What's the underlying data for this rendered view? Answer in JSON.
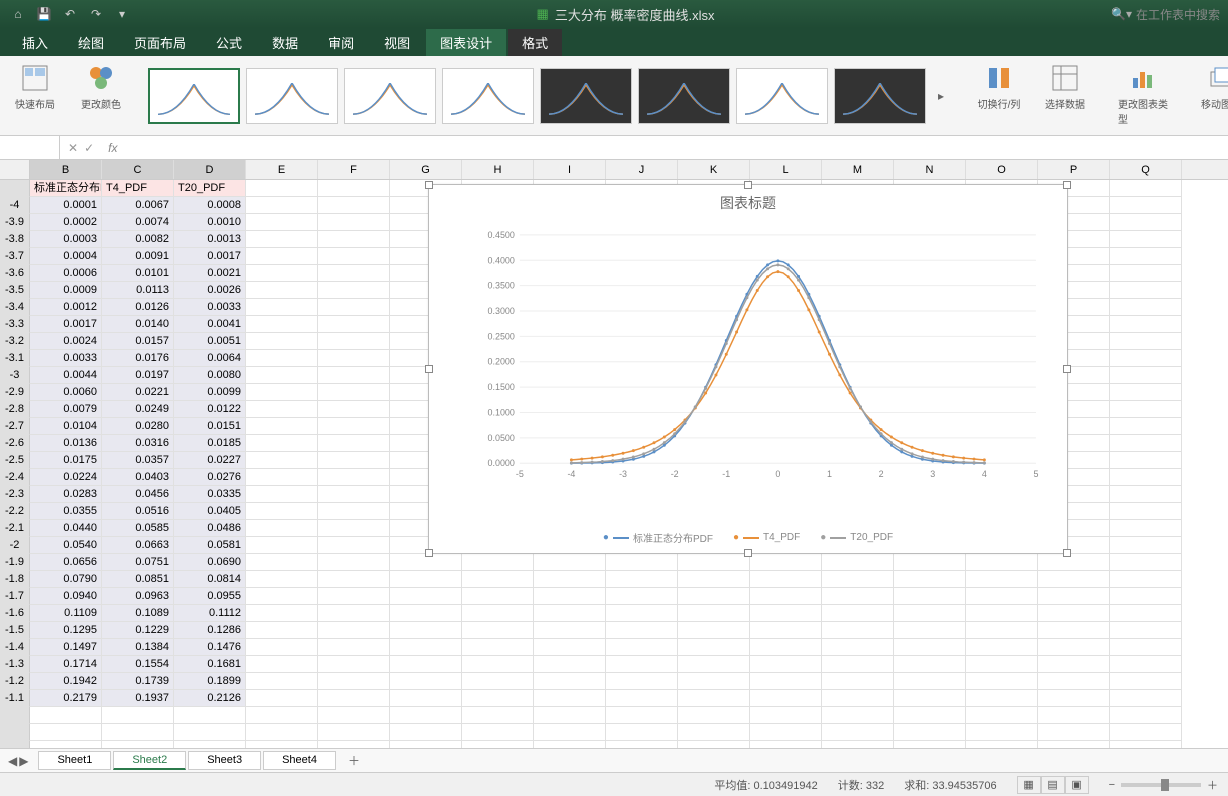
{
  "titlebar": {
    "filename": "三大分布 概率密度曲线.xlsx",
    "search_placeholder": "在工作表中搜索"
  },
  "tabs": [
    "插入",
    "绘图",
    "页面布局",
    "公式",
    "数据",
    "审阅",
    "视图",
    "图表设计",
    "格式"
  ],
  "active_tab": 7,
  "ribbon": {
    "quick_layout": "快速布局",
    "change_color": "更改颜色",
    "switch_rc": "切换行/列",
    "select_data": "选择数据",
    "change_type": "更改图表类型",
    "move_chart": "移动图表"
  },
  "columns": [
    "",
    "B",
    "C",
    "D",
    "E",
    "F",
    "G",
    "H",
    "I",
    "J",
    "K",
    "L",
    "M",
    "N",
    "O",
    "P",
    "Q"
  ],
  "headers": [
    "标准正态分布PDF",
    "T4_PDF",
    "T20_PDF"
  ],
  "rows": [
    {
      "x": "-4",
      "v": [
        "0.0001",
        "0.0067",
        "0.0008"
      ]
    },
    {
      "x": "-3.9",
      "v": [
        "0.0002",
        "0.0074",
        "0.0010"
      ]
    },
    {
      "x": "-3.8",
      "v": [
        "0.0003",
        "0.0082",
        "0.0013"
      ]
    },
    {
      "x": "-3.7",
      "v": [
        "0.0004",
        "0.0091",
        "0.0017"
      ]
    },
    {
      "x": "-3.6",
      "v": [
        "0.0006",
        "0.0101",
        "0.0021"
      ]
    },
    {
      "x": "-3.5",
      "v": [
        "0.0009",
        "0.0113",
        "0.0026"
      ]
    },
    {
      "x": "-3.4",
      "v": [
        "0.0012",
        "0.0126",
        "0.0033"
      ]
    },
    {
      "x": "-3.3",
      "v": [
        "0.0017",
        "0.0140",
        "0.0041"
      ]
    },
    {
      "x": "-3.2",
      "v": [
        "0.0024",
        "0.0157",
        "0.0051"
      ]
    },
    {
      "x": "-3.1",
      "v": [
        "0.0033",
        "0.0176",
        "0.0064"
      ]
    },
    {
      "x": "-3",
      "v": [
        "0.0044",
        "0.0197",
        "0.0080"
      ]
    },
    {
      "x": "-2.9",
      "v": [
        "0.0060",
        "0.0221",
        "0.0099"
      ]
    },
    {
      "x": "-2.8",
      "v": [
        "0.0079",
        "0.0249",
        "0.0122"
      ]
    },
    {
      "x": "-2.7",
      "v": [
        "0.0104",
        "0.0280",
        "0.0151"
      ]
    },
    {
      "x": "-2.6",
      "v": [
        "0.0136",
        "0.0316",
        "0.0185"
      ]
    },
    {
      "x": "-2.5",
      "v": [
        "0.0175",
        "0.0357",
        "0.0227"
      ]
    },
    {
      "x": "-2.4",
      "v": [
        "0.0224",
        "0.0403",
        "0.0276"
      ]
    },
    {
      "x": "-2.3",
      "v": [
        "0.0283",
        "0.0456",
        "0.0335"
      ]
    },
    {
      "x": "-2.2",
      "v": [
        "0.0355",
        "0.0516",
        "0.0405"
      ]
    },
    {
      "x": "-2.1",
      "v": [
        "0.0440",
        "0.0585",
        "0.0486"
      ]
    },
    {
      "x": "-2",
      "v": [
        "0.0540",
        "0.0663",
        "0.0581"
      ]
    },
    {
      "x": "-1.9",
      "v": [
        "0.0656",
        "0.0751",
        "0.0690"
      ]
    },
    {
      "x": "-1.8",
      "v": [
        "0.0790",
        "0.0851",
        "0.0814"
      ]
    },
    {
      "x": "-1.7",
      "v": [
        "0.0940",
        "0.0963",
        "0.0955"
      ]
    },
    {
      "x": "-1.6",
      "v": [
        "0.1109",
        "0.1089",
        "0.1112"
      ]
    },
    {
      "x": "-1.5",
      "v": [
        "0.1295",
        "0.1229",
        "0.1286"
      ]
    },
    {
      "x": "-1.4",
      "v": [
        "0.1497",
        "0.1384",
        "0.1476"
      ]
    },
    {
      "x": "-1.3",
      "v": [
        "0.1714",
        "0.1554",
        "0.1681"
      ]
    },
    {
      "x": "-1.2",
      "v": [
        "0.1942",
        "0.1739",
        "0.1899"
      ]
    },
    {
      "x": "-1.1",
      "v": [
        "0.2179",
        "0.1937",
        "0.2126"
      ]
    }
  ],
  "chart": {
    "title": "图表标题",
    "legend": [
      "标准正态分布PDF",
      "T4_PDF",
      "T20_PDF"
    ],
    "colors": [
      "#5b8fc7",
      "#e8903a",
      "#a0a0a0"
    ]
  },
  "chart_data": {
    "type": "line",
    "title": "图表标题",
    "xlabel": "",
    "ylabel": "",
    "xlim": [
      -5,
      5
    ],
    "ylim": [
      0,
      0.45
    ],
    "x_ticks": [
      -5,
      -4,
      -3,
      -2,
      -1,
      0,
      1,
      2,
      3,
      4,
      5
    ],
    "y_ticks": [
      0.0,
      0.05,
      0.1,
      0.15,
      0.2,
      0.25,
      0.3,
      0.35,
      0.4,
      0.45
    ],
    "x": [
      -4,
      -3.9,
      -3.8,
      -3.7,
      -3.6,
      -3.5,
      -3.4,
      -3.3,
      -3.2,
      -3.1,
      -3,
      -2.9,
      -2.8,
      -2.7,
      -2.6,
      -2.5,
      -2.4,
      -2.3,
      -2.2,
      -2.1,
      -2,
      -1.9,
      -1.8,
      -1.7,
      -1.6,
      -1.5,
      -1.4,
      -1.3,
      -1.2,
      -1.1,
      -1,
      -0.9,
      -0.8,
      -0.7,
      -0.6,
      -0.5,
      -0.4,
      -0.3,
      -0.2,
      -0.1,
      0,
      0.1,
      0.2,
      0.3,
      0.4,
      0.5,
      0.6,
      0.7,
      0.8,
      0.9,
      1,
      1.1,
      1.2,
      1.3,
      1.4,
      1.5,
      1.6,
      1.7,
      1.8,
      1.9,
      2,
      2.1,
      2.2,
      2.3,
      2.4,
      2.5,
      2.6,
      2.7,
      2.8,
      2.9,
      3,
      3.1,
      3.2,
      3.3,
      3.4,
      3.5,
      3.6,
      3.7,
      3.8,
      3.9,
      4
    ],
    "series": [
      {
        "name": "标准正态分布PDF",
        "color": "#5b8fc7",
        "values": [
          0.0001,
          0.0002,
          0.0003,
          0.0004,
          0.0006,
          0.0009,
          0.0012,
          0.0017,
          0.0024,
          0.0033,
          0.0044,
          0.006,
          0.0079,
          0.0104,
          0.0136,
          0.0175,
          0.0224,
          0.0283,
          0.0355,
          0.044,
          0.054,
          0.0656,
          0.079,
          0.094,
          0.1109,
          0.1295,
          0.1497,
          0.1714,
          0.1942,
          0.2179,
          0.242,
          0.2661,
          0.2897,
          0.3123,
          0.3332,
          0.3521,
          0.3683,
          0.3814,
          0.391,
          0.397,
          0.3989,
          0.397,
          0.391,
          0.3814,
          0.3683,
          0.3521,
          0.3332,
          0.3123,
          0.2897,
          0.2661,
          0.242,
          0.2179,
          0.1942,
          0.1714,
          0.1497,
          0.1295,
          0.1109,
          0.094,
          0.079,
          0.0656,
          0.054,
          0.044,
          0.0355,
          0.0283,
          0.0224,
          0.0175,
          0.0136,
          0.0104,
          0.0079,
          0.006,
          0.0044,
          0.0033,
          0.0024,
          0.0017,
          0.0012,
          0.0009,
          0.0006,
          0.0004,
          0.0003,
          0.0002,
          0.0001
        ]
      },
      {
        "name": "T4_PDF",
        "color": "#e8903a",
        "values": [
          0.0067,
          0.0074,
          0.0082,
          0.0091,
          0.0101,
          0.0113,
          0.0126,
          0.014,
          0.0157,
          0.0176,
          0.0197,
          0.0221,
          0.0249,
          0.028,
          0.0316,
          0.0357,
          0.0403,
          0.0456,
          0.0516,
          0.0585,
          0.0663,
          0.0751,
          0.0851,
          0.0963,
          0.1089,
          0.1229,
          0.1384,
          0.1554,
          0.1739,
          0.1937,
          0.2147,
          0.2365,
          0.2587,
          0.2809,
          0.3023,
          0.3224,
          0.3404,
          0.3557,
          0.3675,
          0.3751,
          0.3776,
          0.3751,
          0.3675,
          0.3557,
          0.3404,
          0.3224,
          0.3023,
          0.2809,
          0.2587,
          0.2365,
          0.2147,
          0.1937,
          0.1739,
          0.1554,
          0.1384,
          0.1229,
          0.1089,
          0.0963,
          0.0851,
          0.0751,
          0.0663,
          0.0585,
          0.0516,
          0.0456,
          0.0403,
          0.0357,
          0.0316,
          0.028,
          0.0249,
          0.0221,
          0.0197,
          0.0176,
          0.0157,
          0.014,
          0.0126,
          0.0113,
          0.0101,
          0.0091,
          0.0082,
          0.0074,
          0.0067
        ]
      },
      {
        "name": "T20_PDF",
        "color": "#a0a0a0",
        "values": [
          0.0008,
          0.001,
          0.0013,
          0.0017,
          0.0021,
          0.0026,
          0.0033,
          0.0041,
          0.0051,
          0.0064,
          0.008,
          0.0099,
          0.0122,
          0.0151,
          0.0185,
          0.0227,
          0.0276,
          0.0335,
          0.0405,
          0.0486,
          0.0581,
          0.069,
          0.0814,
          0.0955,
          0.1112,
          0.1286,
          0.1476,
          0.1681,
          0.1899,
          0.2126,
          0.236,
          0.2596,
          0.2829,
          0.3054,
          0.3262,
          0.345,
          0.361,
          0.3738,
          0.3832,
          0.389,
          0.391,
          0.389,
          0.3832,
          0.3738,
          0.361,
          0.345,
          0.3262,
          0.3054,
          0.2829,
          0.2596,
          0.236,
          0.2126,
          0.1899,
          0.1681,
          0.1476,
          0.1286,
          0.1112,
          0.0955,
          0.0814,
          0.069,
          0.0581,
          0.0486,
          0.0405,
          0.0335,
          0.0276,
          0.0227,
          0.0185,
          0.0151,
          0.0122,
          0.0099,
          0.008,
          0.0064,
          0.0051,
          0.0041,
          0.0033,
          0.0026,
          0.0021,
          0.0017,
          0.0013,
          0.001,
          0.0008
        ]
      }
    ]
  },
  "sheets": [
    "Sheet1",
    "Sheet2",
    "Sheet3",
    "Sheet4"
  ],
  "active_sheet": 1,
  "status": {
    "avg_label": "平均值:",
    "avg": "0.103491942",
    "count_label": "计数:",
    "count": "332",
    "sum_label": "求和:",
    "sum": "33.94535706"
  }
}
